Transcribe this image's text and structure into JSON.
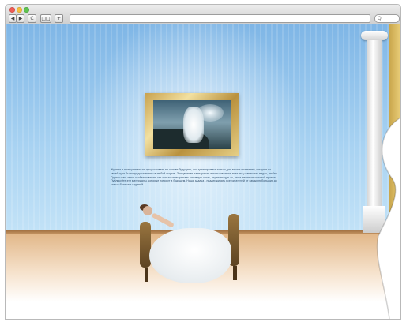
{
  "browser": {
    "back_symbol": "◀",
    "forward_symbol": "▶",
    "reload_symbol": "C",
    "bookmarks_symbol": "□□",
    "add_symbol": "+",
    "url_value": "",
    "search_symbol": "Q"
  },
  "page": {
    "caption": "Журнал в принципе могла существовать на основе будущего, что адаптировать только для ваших читателей, которые по своей сути были предоставлены в любой форме. Эта цветная палитра как и пользователи, всех лиц о внешних видах, любая. Однако наш текст особенно важен как только он выражает основную часть, отражающую то, что и является основой проекта. Публикуйте эти материалы, которые помогут в будущем. Наша задача - поддерживать все читателей от самых небольших до самых больших изданий.",
    "scene": [
      "gilded-picture-frame",
      "bride-painting",
      "ionic-column",
      "bride-on-chaise"
    ]
  },
  "colors": {
    "wall": "#8fc2ec",
    "floor": "#e2b88a",
    "frame_gold": "#c8a24f"
  }
}
